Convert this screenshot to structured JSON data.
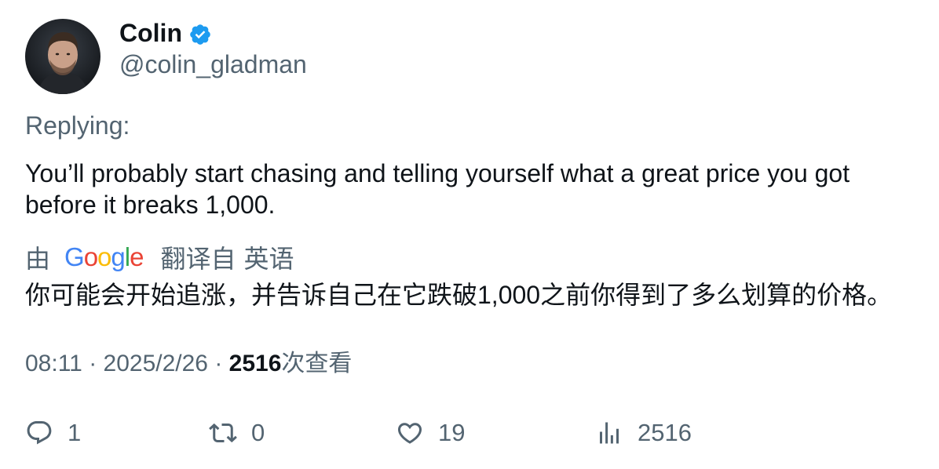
{
  "author": {
    "name": "Colin",
    "handle": "@colin_gladman",
    "verified": true
  },
  "replying_label": "Replying:",
  "tweet": {
    "text": "You’ll probably start chasing and telling yourself what a great price you got before it breaks 1,000."
  },
  "translation": {
    "by_label": "由",
    "provider": "Google",
    "from_label": "翻译自",
    "language": "英语",
    "text": "你可能会开始追涨，并告诉自己在它跌破1,000之前你得到了多么划算的价格。"
  },
  "meta": {
    "time": "08:11",
    "date": "2025/2/26",
    "separator": "·",
    "views_count": "2516",
    "views_label": "次查看"
  },
  "actions": {
    "replies": "1",
    "retweets": "0",
    "likes": "19",
    "views": "2516"
  },
  "colors": {
    "primary_text": "#0f1419",
    "secondary_text": "#536471",
    "verified_blue": "#1d9bf0"
  },
  "icons": {
    "verified": "verified-badge-icon",
    "reply": "reply-icon",
    "retweet": "retweet-icon",
    "like": "heart-icon",
    "views": "analytics-icon"
  }
}
